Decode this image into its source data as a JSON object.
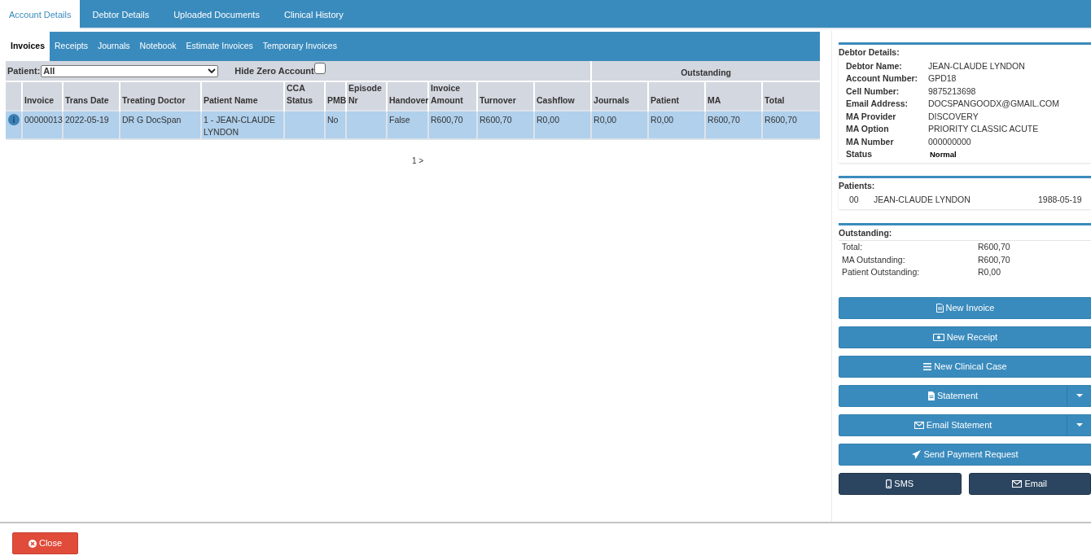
{
  "tabs": [
    {
      "label": "Account Details",
      "selected": true
    },
    {
      "label": "Debtor Details",
      "selected": false
    },
    {
      "label": "Uploaded Documents",
      "selected": false
    },
    {
      "label": "Clinical History",
      "selected": false
    }
  ],
  "subtabs": [
    {
      "label": "Invoices",
      "selected": true
    },
    {
      "label": "Receipts",
      "selected": false
    },
    {
      "label": "Journals",
      "selected": false
    },
    {
      "label": "Notebook",
      "selected": false
    },
    {
      "label": "Estimate Invoices",
      "selected": false
    },
    {
      "label": "Temporary Invoices",
      "selected": false
    }
  ],
  "filter": {
    "patient_label": "Patient:",
    "patient_value": "All",
    "hide_zero_label": "Hide Zero Account",
    "hide_zero_checked": false
  },
  "table": {
    "group_header": "Outstanding",
    "columns": [
      "Invoice",
      "Trans Date",
      "Treating Doctor",
      "Patient Name",
      "CCA Status",
      "PMB",
      "Episode Nr",
      "Handover",
      "Invoice Amount",
      "Turnover",
      "Cashflow",
      "Journals",
      "Patient",
      "MA",
      "Total"
    ],
    "rows": [
      {
        "selected": true,
        "cells": [
          "00000013",
          "2022-05-19",
          "DR G DocSpan",
          "1 - JEAN-CLAUDE LYNDON",
          "",
          "No",
          "",
          "False",
          "R600,70",
          "R600,70",
          "R0,00",
          "R0,00",
          "R0,00",
          "R600,70",
          "R600,70"
        ]
      }
    ]
  },
  "pagination": "1 >",
  "debtor_details": {
    "title": "Debtor Details:",
    "fields": [
      {
        "label": "Debtor Name:",
        "value": "JEAN-CLAUDE LYNDON",
        "kind": "text"
      },
      {
        "label": "Account Number:",
        "value": "GPD18",
        "kind": "text"
      },
      {
        "label": "Cell Number:",
        "value": "9875213698",
        "kind": "text"
      },
      {
        "label": "Email Address:",
        "value": "DOCSPANGOODX@GMAIL.COM",
        "kind": "text"
      },
      {
        "label": "MA Provider",
        "value": "DISCOVERY",
        "kind": "text"
      },
      {
        "label": "MA Option",
        "value": "PRIORITY CLASSIC ACUTE",
        "kind": "text"
      },
      {
        "label": "MA Number",
        "value": "000000000",
        "kind": "text"
      },
      {
        "label": "Status",
        "value": "Normal",
        "kind": "status"
      }
    ]
  },
  "patients": {
    "title": "Patients:",
    "rows": [
      {
        "number": "00",
        "name": "JEAN-CLAUDE LYNDON",
        "birth_date": "1988-05-19"
      }
    ]
  },
  "outstanding": {
    "title": "Outstanding:",
    "rows": [
      {
        "label": "Total:",
        "value": "R600,70"
      },
      {
        "label": "MA Outstanding:",
        "value": "R600,70"
      },
      {
        "label": "Patient Outstanding:",
        "value": "R0,00"
      }
    ]
  },
  "actions": [
    {
      "label": "New Invoice",
      "kind": "primary"
    },
    {
      "label": "New Receipt",
      "kind": "primary"
    },
    {
      "label": "New Clinical Case",
      "kind": "primary"
    },
    {
      "label": "Statement",
      "kind": "split"
    },
    {
      "label": "Email Statement",
      "kind": "split"
    },
    {
      "label": "Send Payment Request",
      "kind": "primary"
    }
  ],
  "contact_actions": [
    {
      "label": "SMS"
    },
    {
      "label": "Email"
    }
  ],
  "close_button": "Close"
}
